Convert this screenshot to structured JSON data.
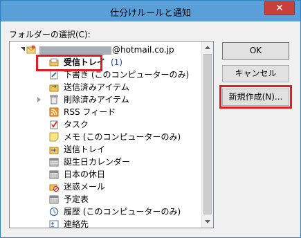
{
  "window": {
    "title": "仕分けルールと通知",
    "close_label": "✕"
  },
  "folder_select_label": "フォルダーの選択(C):",
  "account": {
    "email_suffix": "@hotmail.co.jp"
  },
  "tree_items": [
    {
      "label": "受信トレイ",
      "count": "(1)",
      "icon": "inbox-icon"
    },
    {
      "label": "下書き (このコンピューターのみ)",
      "icon": "drafts-icon"
    },
    {
      "label": "送信済みアイテム",
      "icon": "sent-items-icon"
    },
    {
      "label": "削除済みアイテム",
      "icon": "trash-icon"
    },
    {
      "label": "RSS フィード",
      "icon": "rss-icon"
    },
    {
      "label": "タスク",
      "icon": "task-icon"
    },
    {
      "label": "メモ (このコンピューターのみ)",
      "icon": "note-icon"
    },
    {
      "label": "送信トレイ",
      "icon": "outbox-icon"
    },
    {
      "label": "誕生日カレンダー",
      "icon": "calendar-icon"
    },
    {
      "label": "日本の休日",
      "icon": "calendar-icon"
    },
    {
      "label": "迷惑メール",
      "icon": "junk-mail-icon"
    },
    {
      "label": "予定表",
      "icon": "calendar-icon"
    },
    {
      "label": "履歴 (このコンピューターのみ)",
      "icon": "history-icon"
    },
    {
      "label": "連絡先",
      "icon": "contacts-icon"
    }
  ],
  "buttons": {
    "ok": "OK",
    "cancel": "キャンセル",
    "new_folder": "新規作成(N)..."
  },
  "colors": {
    "titlebar": "#5a9fd8",
    "close": "#c7403a",
    "highlight": "#e01c24",
    "count": "#1e4cb3"
  }
}
